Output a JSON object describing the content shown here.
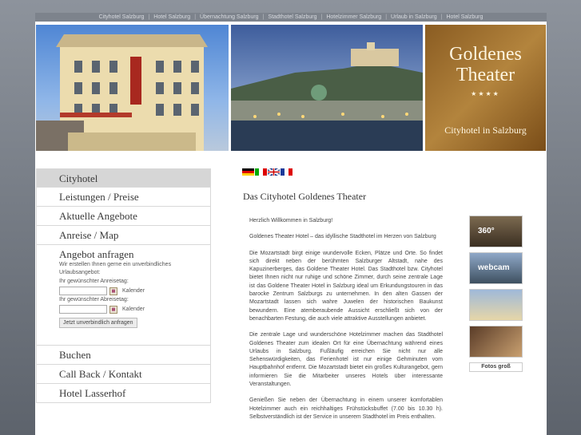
{
  "topnav": [
    "Cityhotel Salzburg",
    "Hotel Salzburg",
    "Übernachtung Salzburg",
    "Stadthotel Salzburg",
    "Hotelzimmer Salzburg",
    "Urlaub in Salzburg",
    "Hotel Salzburg"
  ],
  "banner": {
    "brand_line1": "Goldenes",
    "brand_line2": "Theater",
    "stars": "★★★★",
    "tagline": "Cityhotel in Salzburg"
  },
  "menu": [
    "Cityhotel",
    "Leistungen / Preise",
    "Aktuelle Angebote",
    "Anreise / Map"
  ],
  "offer": {
    "title": "Angebot anfragen",
    "intro": "Wir erstellen Ihnen gerne ein unverbindliches Urlaubsangebot:",
    "arrival_label": "Ihr gewünschter Anreisetag:",
    "departure_label": "Ihr gewünschter Abreisetag:",
    "calendar_label": "Kalender",
    "submit": "Jetzt unverbindlich anfragen"
  },
  "menu2": [
    "Buchen",
    "Call Back / Kontakt",
    "Hotel Lasserhof"
  ],
  "content": {
    "title": "Das Cityhotel Goldenes Theater",
    "p1": "Herzlich Willkommen in Salzburg!",
    "p2": "Goldenes Theater Hotel – das idyllische Stadthotel im Herzen von Salzburg",
    "p3": "Die Mozartstadt birgt einige wundervolle Ecken, Plätze und Orte. So findet sich direkt neben der berühmten Salzburger Altstadt, nahe des Kapuzinerberges, das Goldene Theater Hotel. Das Stadthotel bzw. Cityhotel bietet Ihnen nicht nur ruhige und schöne Zimmer, durch seine zentrale Lage ist das Goldene Theater Hotel in Salzburg ideal um Erkundungstouren in das barocke Zentrum Salzburgs zu unternehmen. In den alten Gassen der Mozartstadt lassen sich wahre Juwelen der historischen Baukunst bewundern. Eine atemberaubende Aussicht erschließt sich von der benachbarten Festung, die auch viele attraktive Ausstellungen anbietet.",
    "p4": "Die zentrale Lage und wunderschöne Hotelzimmer machen das Stadthotel Goldenes Theater zum idealen Ort für eine Übernachtung während eines Urlaubs in Salzburg. Fußläufig erreichen Sie nicht nur alle Sehenswürdigkeiten, das Ferienhotel ist nur einige Gehminuten vom Hauptbahnhof entfernt. Die Mozartstadt bietet ein großes Kulturangebot, gern informieren Sie die Mitarbeiter unseres Hotels über interessante Veranstaltungen.",
    "p5": "Genießen Sie neben der Übernachtung in einem unserer komfortablen Hotelzimmer auch ein reichhaltiges Frühstücksbuffet (7.00 bis 10.30 h). Selbstverständlich ist der Service in unserem Stadthotel im Preis enthalten."
  },
  "thumbs": {
    "t1": "360°",
    "t2": "webcam",
    "fotos": "Fotos groß"
  }
}
